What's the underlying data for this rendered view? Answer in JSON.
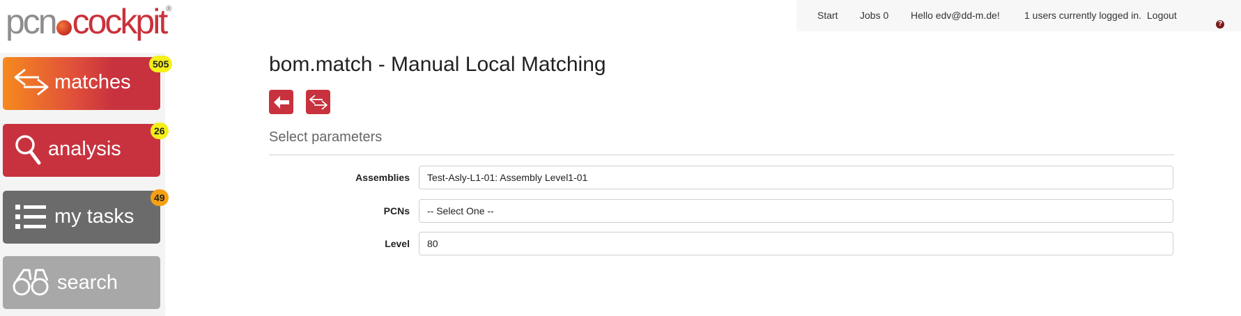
{
  "logo": {
    "pcn": "pcn",
    "cockpit": "cockpit",
    "reg": "®"
  },
  "topnav": {
    "start": "Start",
    "jobs": "Jobs 0",
    "hello": "Hello edv@dd-m.de!",
    "users": "1 users currently logged in.",
    "logout": "Logout",
    "help": "?"
  },
  "sidebar": {
    "tiles": [
      {
        "label": "matches",
        "badge": "505",
        "icon": "arrows-exchange-icon"
      },
      {
        "label": "analysis",
        "badge": "26",
        "icon": "magnifier-icon"
      },
      {
        "label": "my tasks",
        "badge": "49",
        "icon": "list-icon"
      },
      {
        "label": "search",
        "badge": "",
        "icon": "binoculars-icon"
      }
    ]
  },
  "main": {
    "title": "bom.match - Manual Local Matching",
    "buttons": [
      {
        "icon": "back-arrow-icon"
      },
      {
        "icon": "arrows-exchange-icon"
      }
    ],
    "section_title": "Select parameters",
    "fields": [
      {
        "label": "Assemblies",
        "value": "Test-Asly-L1-01: Assembly Level1-01"
      },
      {
        "label": "PCNs",
        "value": "-- Select One --"
      },
      {
        "label": "Level",
        "value": "80"
      }
    ]
  },
  "colors": {
    "brand_red": "#c8323e",
    "brand_orange": "#f68a1e",
    "tile_gray": "#6b6b6b",
    "tile_light_gray": "#a8a8a8",
    "badge_yellow": "#f5ef1a",
    "badge_orange": "#f5a013"
  }
}
